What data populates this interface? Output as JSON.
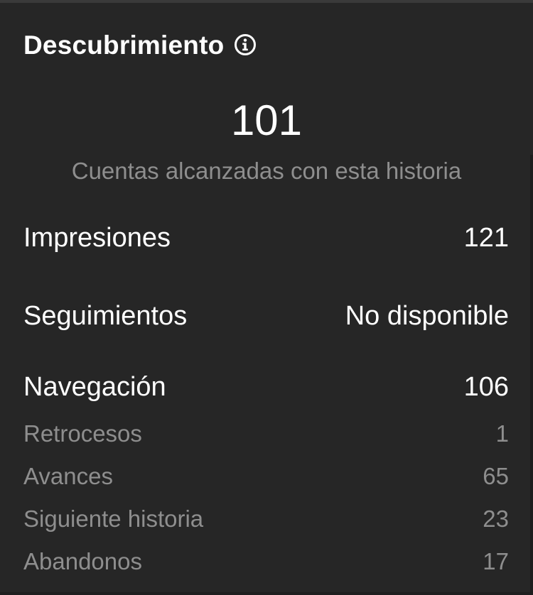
{
  "section": {
    "title": "Descubrimiento",
    "info_icon": "info-circle-icon"
  },
  "reach": {
    "value": "101",
    "caption": "Cuentas alcanzadas con esta historia"
  },
  "metrics": {
    "impressions": {
      "label": "Impresiones",
      "value": "121"
    },
    "follows": {
      "label": "Seguimientos",
      "value": "No disponible"
    },
    "navigation": {
      "label": "Navegación",
      "value": "106"
    }
  },
  "navigation_breakdown": [
    {
      "label": "Retrocesos",
      "value": "1"
    },
    {
      "label": "Avances",
      "value": "65"
    },
    {
      "label": "Siguiente historia",
      "value": "23"
    },
    {
      "label": "Abandonos",
      "value": "17"
    }
  ],
  "colors": {
    "background": "#262626",
    "primary_text": "#ffffff",
    "secondary_text": "#8e8e8e"
  }
}
